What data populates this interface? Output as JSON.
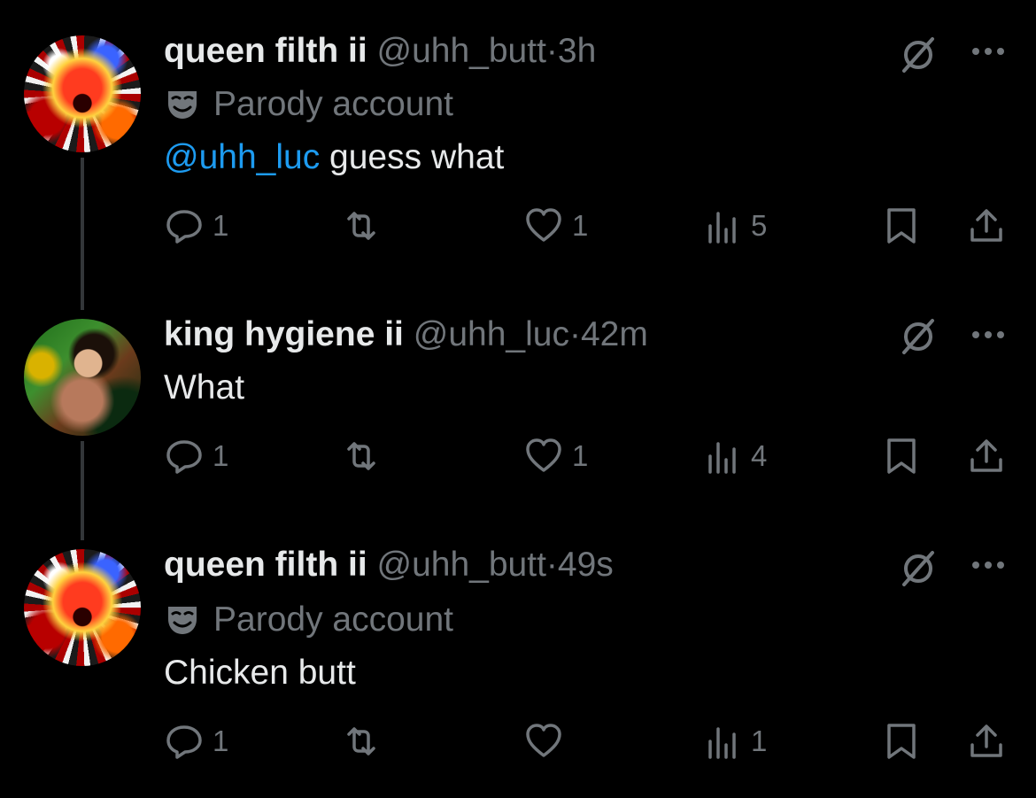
{
  "tweets": [
    {
      "name": "queen filth ii",
      "handle": "@uhh_butt",
      "separator": "·",
      "time": "3h",
      "parody_label": "Parody account",
      "mention": "@uhh_luc",
      "text": " guess what",
      "metrics": {
        "replies": "1",
        "reposts": "",
        "likes": "1",
        "views": "5"
      }
    },
    {
      "name": "king hygiene ii",
      "handle": "@uhh_luc",
      "separator": "·",
      "time": "42m",
      "text": "What",
      "metrics": {
        "replies": "1",
        "reposts": "",
        "likes": "1",
        "views": "4"
      }
    },
    {
      "name": "queen filth ii",
      "handle": "@uhh_butt",
      "separator": "·",
      "time": "49s",
      "parody_label": "Parody account",
      "text": "Chicken butt",
      "metrics": {
        "replies": "1",
        "reposts": "",
        "likes": "",
        "views": "1"
      }
    }
  ],
  "icons": {
    "reply": "reply-icon",
    "repost": "repost-icon",
    "like": "like-icon",
    "views": "views-icon",
    "bookmark": "bookmark-icon",
    "share": "share-icon",
    "grok": "grok-icon",
    "more": "more-icon",
    "parody": "parody-mask-icon"
  },
  "colors": {
    "background": "#000000",
    "text": "#e7e9ea",
    "secondary": "#71767b",
    "link": "#1d9bf0"
  }
}
